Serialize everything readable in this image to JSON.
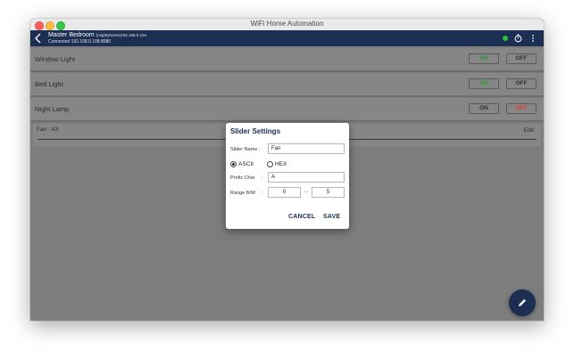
{
  "window": {
    "title": "WiFi Home Automation"
  },
  "appbar": {
    "room": "Master Bedroom",
    "device_info": "(mightyhome)192.168.0.104",
    "connection": "Connected 192.168.0.108:8080",
    "status_color": "#2fbf3a"
  },
  "switches": [
    {
      "name": "Window Light",
      "on_label": "ON",
      "off_label": "OFF",
      "state": "on"
    },
    {
      "name": "Bed Light",
      "on_label": "ON",
      "off_label": "OFF",
      "state": "on"
    },
    {
      "name": "Night Lamp",
      "on_label": "ON",
      "off_label": "OFF",
      "state": "off"
    }
  ],
  "slider": {
    "label": "Fan : A3",
    "edit_label": "Edit"
  },
  "dialog": {
    "title": "Slider Settings",
    "name_label": "Slider Name :",
    "name_value": "Fan",
    "ascii_label": "ASCII",
    "hex_label": "HEX",
    "selected_format": "ASCII",
    "prefix_label": "Prefix Char",
    "prefix_colon": ":",
    "prefix_value": "A",
    "range_label": "Range B/W",
    "range_colon": ":",
    "range_min": "0",
    "range_sep": "...",
    "range_max": "5",
    "cancel_label": "CANCEL",
    "save_label": "SAVE"
  },
  "icons": {
    "back": "chevron-left-icon",
    "timer": "timer-icon",
    "more": "more-vertical-icon",
    "fab": "pencil-icon"
  },
  "colors": {
    "navy": "#1c2e52",
    "on_green": "#1f9a2c",
    "off_red": "#e03a2f",
    "inactive": "#2e2e2e"
  }
}
